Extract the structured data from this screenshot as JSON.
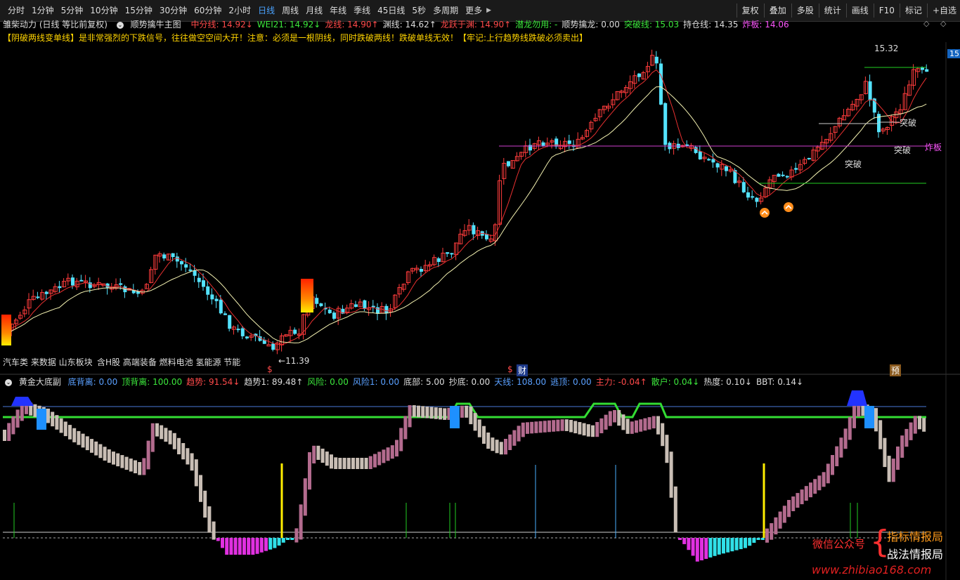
{
  "toolbar": {
    "periods": [
      "分时",
      "1分钟",
      "5分钟",
      "10分钟",
      "15分钟",
      "30分钟",
      "60分钟",
      "2小时",
      "日线",
      "周线",
      "月线",
      "年线",
      "季线",
      "45日线",
      "5秒",
      "多周期",
      "更多"
    ],
    "active_period": "日线",
    "right_buttons": [
      "复权",
      "叠加",
      "多股",
      "统计",
      "画线",
      "F10",
      "标记",
      "+自选"
    ]
  },
  "main_header": {
    "title": "雏柴动力 (日线 等比前复权)",
    "indicator": "顺势擒牛主图",
    "values": [
      {
        "label": "中分线: 14.92",
        "color": "red",
        "arrow": "↓"
      },
      {
        "label": "WEI21: 14.92",
        "color": "green",
        "arrow": "↓"
      },
      {
        "label": "龙线: 14.90",
        "color": "red",
        "arrow": "↑"
      },
      {
        "label": "渊线: 14.62",
        "color": "white",
        "arrow": "↑"
      },
      {
        "label": "龙跃于渊: 14.90",
        "color": "red",
        "arrow": "↑"
      },
      {
        "label": "潜龙勿用: -",
        "color": "green",
        "arrow": ""
      },
      {
        "label": "顺势擒龙: 0.00",
        "color": "white",
        "arrow": ""
      },
      {
        "label": "突破线: 15.03",
        "color": "green",
        "arrow": ""
      },
      {
        "label": "持仓线: 14.35",
        "color": "white",
        "arrow": ""
      },
      {
        "label": "炸板: 14.06",
        "color": "magenta",
        "arrow": ""
      }
    ]
  },
  "notice": "【阴破两线变单线】是非常强烈的下跌信号，往往做空空间大开！注意：必须是一根阴线，同时跌破两线！跌破单线无效！【牢记:上行趋势线跌破必须卖出】",
  "chart_labels": {
    "high_price": "15.32",
    "low_price": "11.39",
    "breakthrough_1": "突破",
    "breakthrough_2": "突破",
    "breakthrough_3": "突破",
    "zhaban": "炸板",
    "right_price_tag": "15",
    "sectors": "汽车类 来数据 山东板块",
    "concepts": "含H股 高端装备 燃料电池 氢能源 节能",
    "marker_s1": "$",
    "marker_s2": "$",
    "marker_cai": "财",
    "marker_yu": "预"
  },
  "sub_header": {
    "indicator": "黄金大底副",
    "values": [
      {
        "label": "底背离: 0.00",
        "color": "blue",
        "arrow": ""
      },
      {
        "label": "顶背离: 100.00",
        "color": "green",
        "arrow": ""
      },
      {
        "label": "趋势: 91.54",
        "color": "red",
        "arrow": "↓"
      },
      {
        "label": "趋势1: 89.48",
        "color": "white",
        "arrow": "↑"
      },
      {
        "label": "风险: 0.00",
        "color": "green",
        "arrow": ""
      },
      {
        "label": "风险1: 0.00",
        "color": "blue",
        "arrow": ""
      },
      {
        "label": "底部: 5.00",
        "color": "white",
        "arrow": ""
      },
      {
        "label": "抄底: 0.00",
        "color": "white",
        "arrow": ""
      },
      {
        "label": "天线: 108.00",
        "color": "blue",
        "arrow": ""
      },
      {
        "label": "逃顶: 0.00",
        "color": "blue",
        "arrow": ""
      },
      {
        "label": "主力: -0.04",
        "color": "red",
        "arrow": "↑"
      },
      {
        "label": "散户: 0.04",
        "color": "green",
        "arrow": "↓"
      },
      {
        "label": "热度: 0.10",
        "color": "white",
        "arrow": "↓"
      },
      {
        "label": "BBT: 0.14",
        "color": "white",
        "arrow": "↓"
      }
    ]
  },
  "watermark": {
    "wechat": "微信公众号",
    "line1": "指标情报局",
    "line2": "战法情报局",
    "url": "www.zhibiao168.com"
  },
  "colors": {
    "up": "#ff3c3c",
    "down": "#54e3ff",
    "ma_red": "#e83030",
    "ma_yellow": "#f2f0b0",
    "magenta": "#d040d0",
    "green": "#22d022"
  }
}
